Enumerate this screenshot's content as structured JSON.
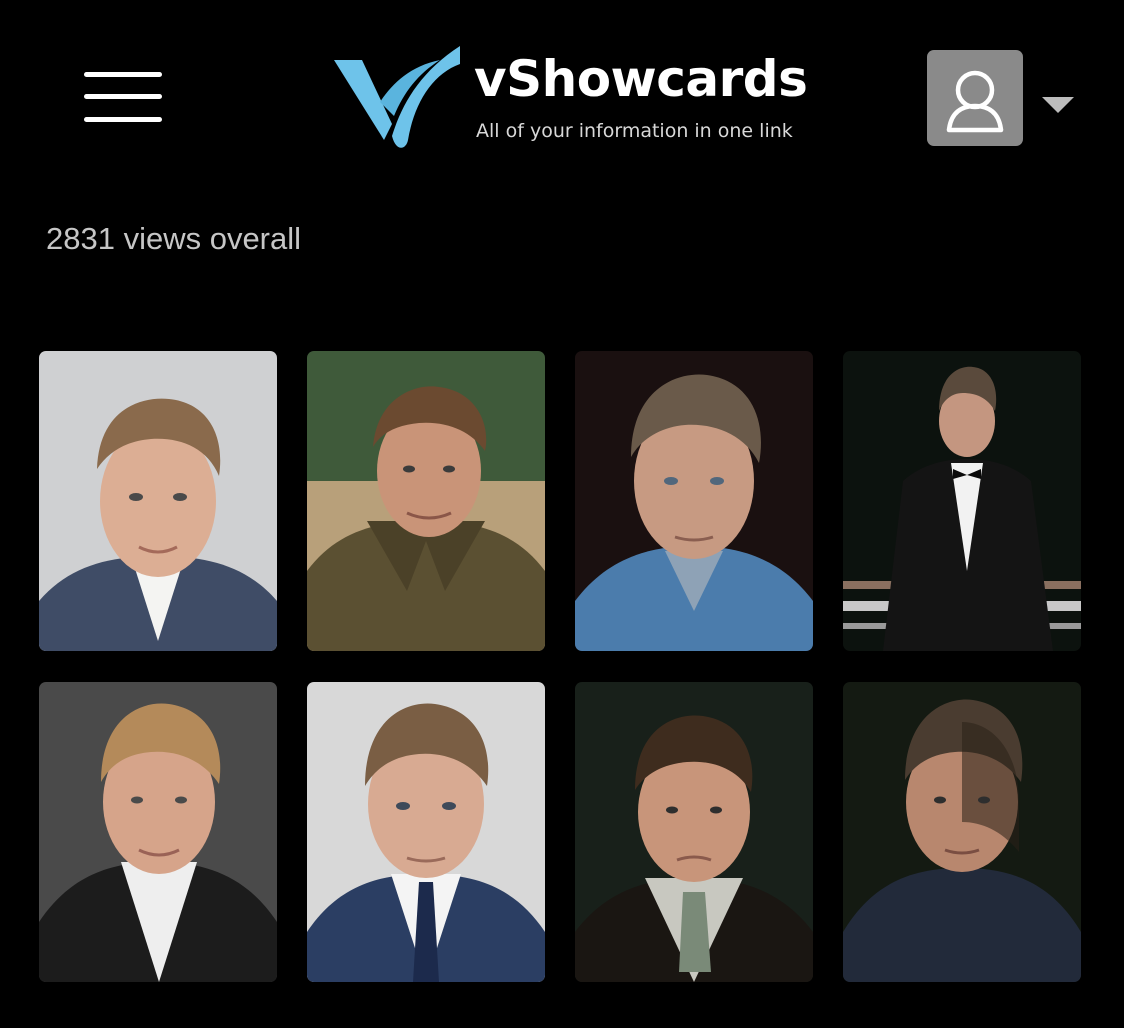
{
  "header": {
    "menu_icon": "hamburger-menu-icon",
    "brand_name": "vShowcards",
    "tagline": "All of your information in one link",
    "brand_accent": "#6ec3ea",
    "user_icon": "user-icon",
    "dropdown_icon": "caret-down-icon"
  },
  "stats": {
    "views_text": "2831 views overall"
  },
  "gallery": {
    "photos": [
      {
        "label": "headshot-1"
      },
      {
        "label": "headshot-2"
      },
      {
        "label": "headshot-3"
      },
      {
        "label": "headshot-4"
      },
      {
        "label": "headshot-5"
      },
      {
        "label": "headshot-6"
      },
      {
        "label": "headshot-7"
      },
      {
        "label": "headshot-8"
      }
    ]
  }
}
